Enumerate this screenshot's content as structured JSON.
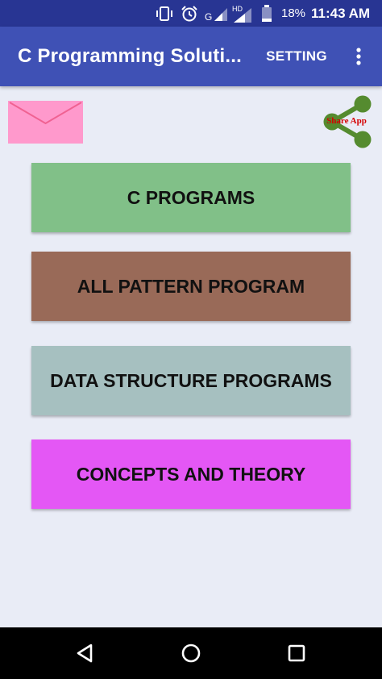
{
  "status_bar": {
    "network_label": "G",
    "hd_label": "HD",
    "battery_percent": "18%",
    "time": "11:43 AM"
  },
  "app_bar": {
    "title": "C Programming Soluti...",
    "setting_label": "SETTING",
    "overflow_icon": "overflow-menu-icon"
  },
  "header_actions": {
    "mail_icon": "envelope-icon",
    "mail_color": "#ff99cc",
    "share_label": "Share App",
    "share_icon_color": "#558b2f",
    "share_label_color": "#d50000"
  },
  "menu": [
    {
      "label": "C PROGRAMS",
      "color": "#81c088"
    },
    {
      "label": "ALL PATTERN PROGRAM",
      "color": "#996a58"
    },
    {
      "label": "DATA STRUCTURE PROGRAMS",
      "color": "#a6c0c0"
    },
    {
      "label": "CONCEPTS AND THEORY",
      "color": "#e457f5"
    }
  ],
  "nav_bar": {
    "back_icon": "back-triangle-icon",
    "home_icon": "home-circle-icon",
    "recents_icon": "recents-square-icon"
  },
  "colors": {
    "status_bar": "#283593",
    "app_bar": "#3f51b5",
    "background": "#e9ecf6"
  }
}
